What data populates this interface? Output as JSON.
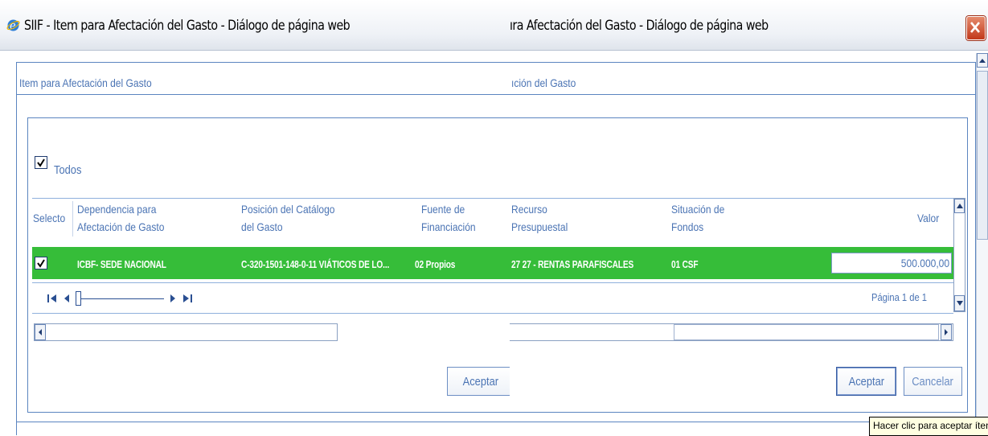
{
  "left_window": {
    "title": "SIIF - Item para Afectación del Gasto - Diálogo de página web",
    "breadcrumb": "Item para Afectación del Gasto",
    "todos_label": "Todos",
    "columns": {
      "select": "Selecto",
      "dependencia_1": "Dependencia para",
      "dependencia_2": "Afectación de Gasto",
      "posicion_1": "Posición del Catálogo",
      "posicion_2": "del Gasto",
      "fuente_1": "Fuente de",
      "fuente_2": "Financiación"
    },
    "row": {
      "dependencia": "ICBF- SEDE NACIONAL",
      "posicion": "C-320-1501-148-0-11 VIÁTICOS DE LO...",
      "fuente": "02 Propios"
    },
    "accept_label": "Aceptar"
  },
  "right_window": {
    "title": "ıra Afectación del Gasto - Diálogo de página web",
    "breadcrumb": "ıción del Gasto",
    "columns": {
      "recurso_1": "Recurso",
      "recurso_2": "Presupuestal",
      "situacion_1": "Situación de",
      "situacion_2": "Fondos",
      "valor": "Valor"
    },
    "row": {
      "recurso": "27 27 - RENTAS PARAFISCALES",
      "situacion": "01 CSF",
      "valor": "500.000,00"
    },
    "page_info": "Página 1 de 1",
    "accept_label": "Aceptar",
    "cancel_label": "Cancelar",
    "tooltip": "Hacer clic para aceptar ítems"
  },
  "colors": {
    "row_green": "#36bd39",
    "text_blue": "#4b74b4",
    "frame_blue": "#5b85c0"
  }
}
